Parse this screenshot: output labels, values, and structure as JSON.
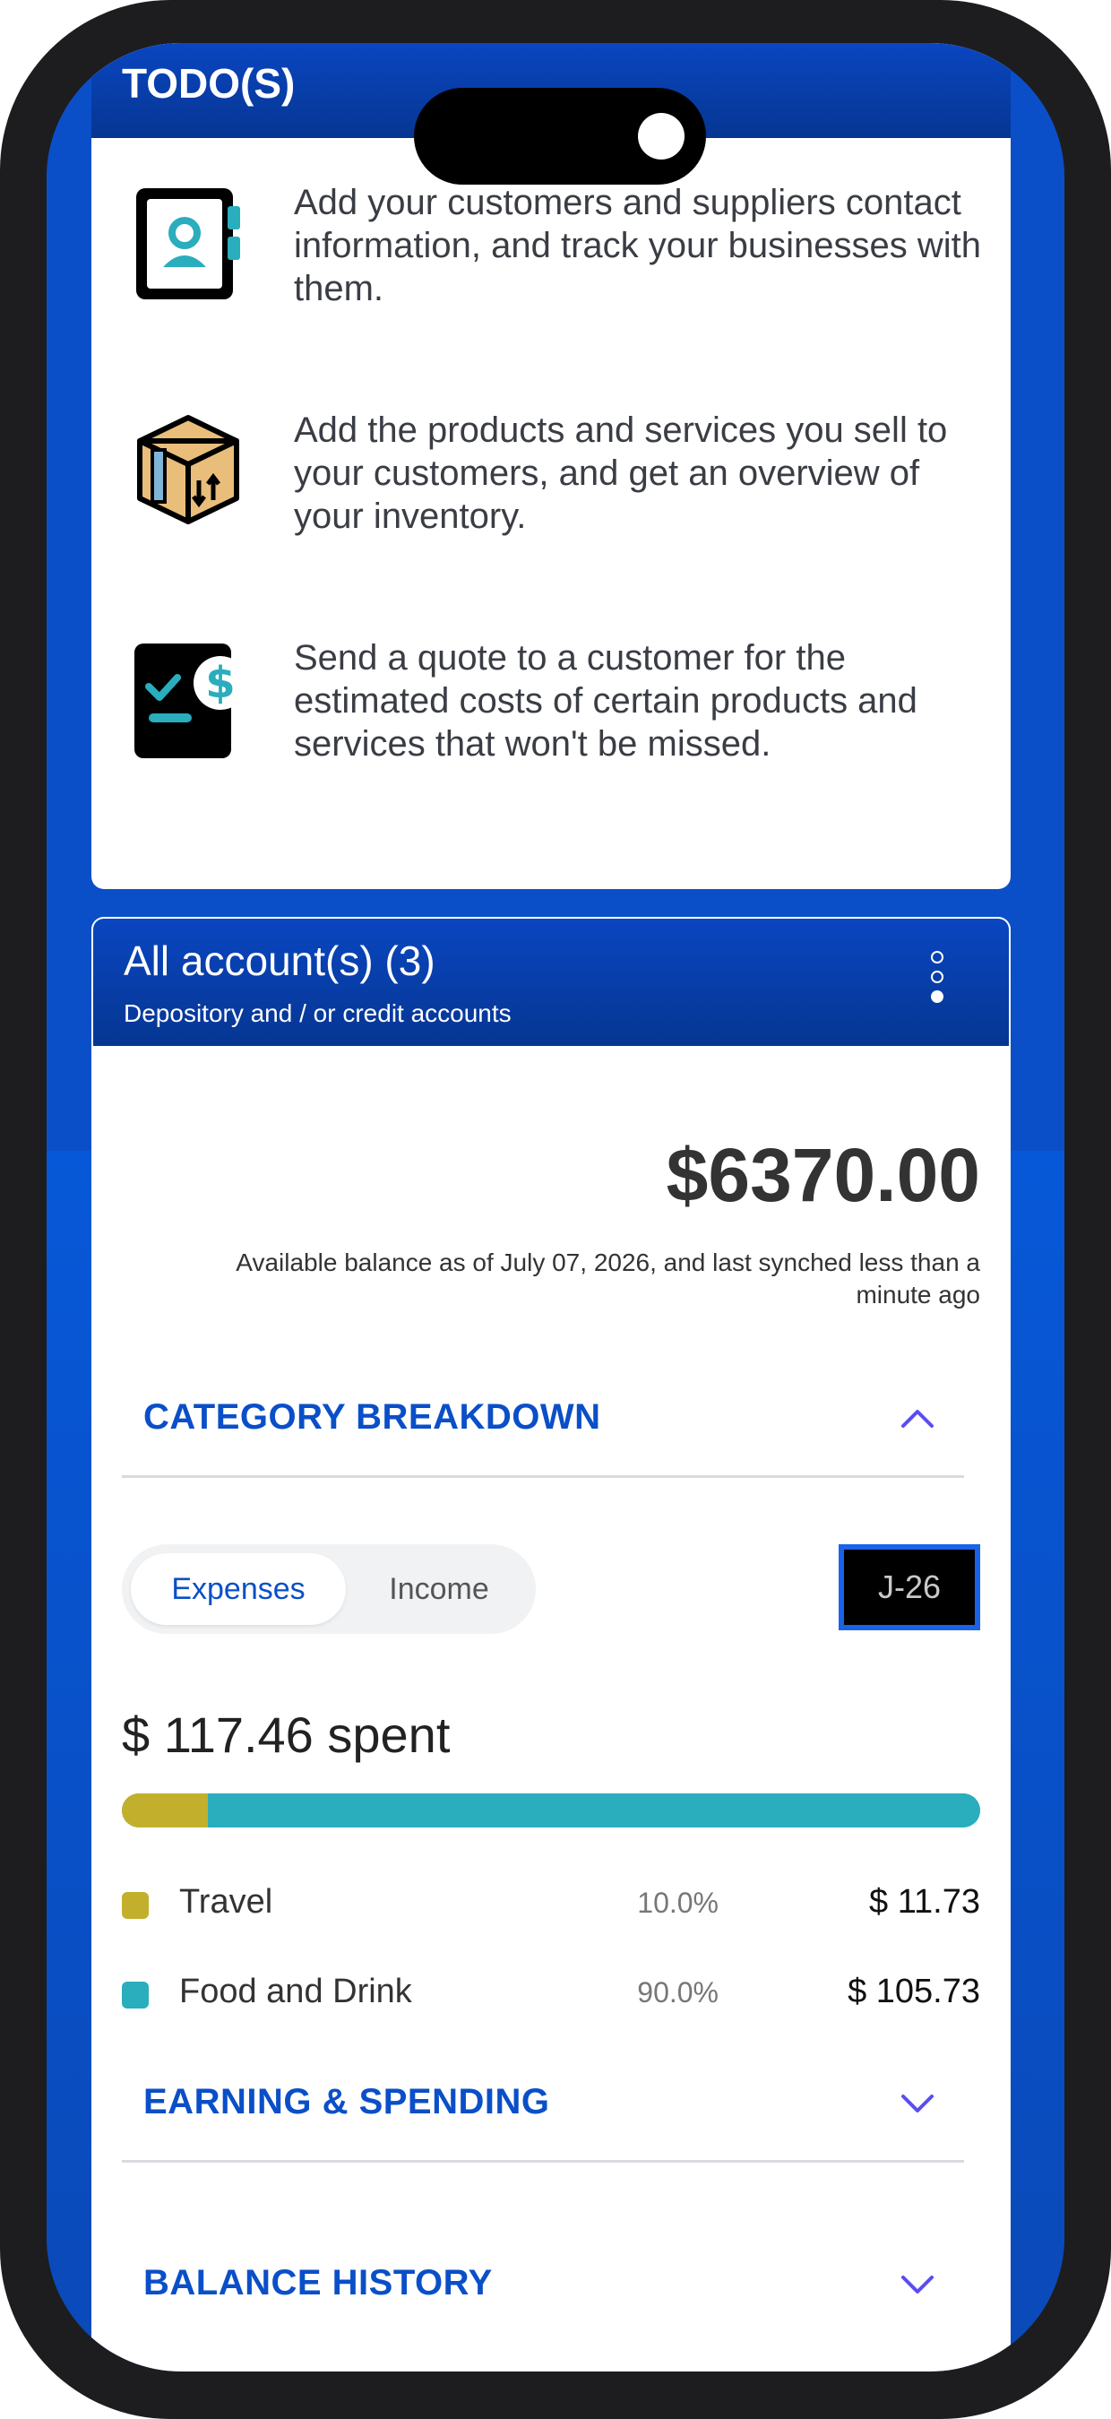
{
  "todos": {
    "title": "TODO(S)",
    "items": [
      {
        "icon": "contacts-icon",
        "text": "Add your customers and suppliers contact information, and track your businesses with them."
      },
      {
        "icon": "inventory-box-icon",
        "text": "Add the products and services you sell to your customers, and get an overview of your inventory."
      },
      {
        "icon": "quote-invoice-icon",
        "text": "Send a quote to a customer for the estimated costs of certain products and services that won't be missed."
      }
    ]
  },
  "accounts": {
    "title": "All account(s) (3)",
    "subtitle": "Depository and / or credit accounts",
    "balance": "$6370.00",
    "balance_note": "Available balance as of July 07, 2026, and last synched less than a minute ago"
  },
  "category_breakdown": {
    "title": "CATEGORY BREAKDOWN",
    "tabs": {
      "active": "Expenses",
      "inactive": "Income"
    },
    "period_button": "J-26",
    "spent_label": "$ 117.46  spent",
    "categories": [
      {
        "name": "Travel",
        "percent": "10.0%",
        "amount": "$ 11.73",
        "share": 0.1,
        "color": "#c2b02c"
      },
      {
        "name": "Food and Drink",
        "percent": "90.0%",
        "amount": "$ 105.73",
        "share": 0.9,
        "color": "#2aadbd"
      }
    ]
  },
  "sections": {
    "earning_spending": "EARNING & SPENDING",
    "balance_history": "BALANCE HISTORY"
  },
  "colors": {
    "brand_blue": "#0a4fc8",
    "travel": "#c2b02c",
    "food": "#2aadbd"
  }
}
